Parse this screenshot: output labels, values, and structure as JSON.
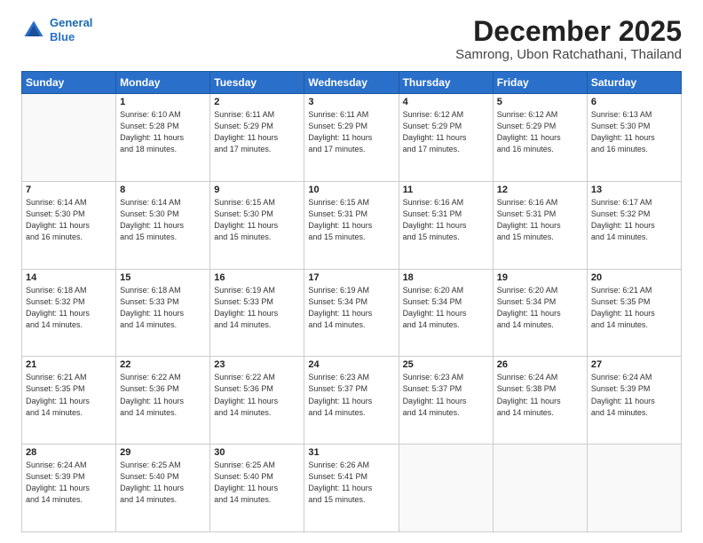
{
  "header": {
    "logo_line1": "General",
    "logo_line2": "Blue",
    "main_title": "December 2025",
    "subtitle": "Samrong, Ubon Ratchathani, Thailand"
  },
  "days_of_week": [
    "Sunday",
    "Monday",
    "Tuesday",
    "Wednesday",
    "Thursday",
    "Friday",
    "Saturday"
  ],
  "weeks": [
    [
      {
        "day": "",
        "info": ""
      },
      {
        "day": "1",
        "info": "Sunrise: 6:10 AM\nSunset: 5:28 PM\nDaylight: 11 hours\nand 18 minutes."
      },
      {
        "day": "2",
        "info": "Sunrise: 6:11 AM\nSunset: 5:29 PM\nDaylight: 11 hours\nand 17 minutes."
      },
      {
        "day": "3",
        "info": "Sunrise: 6:11 AM\nSunset: 5:29 PM\nDaylight: 11 hours\nand 17 minutes."
      },
      {
        "day": "4",
        "info": "Sunrise: 6:12 AM\nSunset: 5:29 PM\nDaylight: 11 hours\nand 17 minutes."
      },
      {
        "day": "5",
        "info": "Sunrise: 6:12 AM\nSunset: 5:29 PM\nDaylight: 11 hours\nand 16 minutes."
      },
      {
        "day": "6",
        "info": "Sunrise: 6:13 AM\nSunset: 5:30 PM\nDaylight: 11 hours\nand 16 minutes."
      }
    ],
    [
      {
        "day": "7",
        "info": "Sunrise: 6:14 AM\nSunset: 5:30 PM\nDaylight: 11 hours\nand 16 minutes."
      },
      {
        "day": "8",
        "info": "Sunrise: 6:14 AM\nSunset: 5:30 PM\nDaylight: 11 hours\nand 15 minutes."
      },
      {
        "day": "9",
        "info": "Sunrise: 6:15 AM\nSunset: 5:30 PM\nDaylight: 11 hours\nand 15 minutes."
      },
      {
        "day": "10",
        "info": "Sunrise: 6:15 AM\nSunset: 5:31 PM\nDaylight: 11 hours\nand 15 minutes."
      },
      {
        "day": "11",
        "info": "Sunrise: 6:16 AM\nSunset: 5:31 PM\nDaylight: 11 hours\nand 15 minutes."
      },
      {
        "day": "12",
        "info": "Sunrise: 6:16 AM\nSunset: 5:31 PM\nDaylight: 11 hours\nand 15 minutes."
      },
      {
        "day": "13",
        "info": "Sunrise: 6:17 AM\nSunset: 5:32 PM\nDaylight: 11 hours\nand 14 minutes."
      }
    ],
    [
      {
        "day": "14",
        "info": "Sunrise: 6:18 AM\nSunset: 5:32 PM\nDaylight: 11 hours\nand 14 minutes."
      },
      {
        "day": "15",
        "info": "Sunrise: 6:18 AM\nSunset: 5:33 PM\nDaylight: 11 hours\nand 14 minutes."
      },
      {
        "day": "16",
        "info": "Sunrise: 6:19 AM\nSunset: 5:33 PM\nDaylight: 11 hours\nand 14 minutes."
      },
      {
        "day": "17",
        "info": "Sunrise: 6:19 AM\nSunset: 5:34 PM\nDaylight: 11 hours\nand 14 minutes."
      },
      {
        "day": "18",
        "info": "Sunrise: 6:20 AM\nSunset: 5:34 PM\nDaylight: 11 hours\nand 14 minutes."
      },
      {
        "day": "19",
        "info": "Sunrise: 6:20 AM\nSunset: 5:34 PM\nDaylight: 11 hours\nand 14 minutes."
      },
      {
        "day": "20",
        "info": "Sunrise: 6:21 AM\nSunset: 5:35 PM\nDaylight: 11 hours\nand 14 minutes."
      }
    ],
    [
      {
        "day": "21",
        "info": "Sunrise: 6:21 AM\nSunset: 5:35 PM\nDaylight: 11 hours\nand 14 minutes."
      },
      {
        "day": "22",
        "info": "Sunrise: 6:22 AM\nSunset: 5:36 PM\nDaylight: 11 hours\nand 14 minutes."
      },
      {
        "day": "23",
        "info": "Sunrise: 6:22 AM\nSunset: 5:36 PM\nDaylight: 11 hours\nand 14 minutes."
      },
      {
        "day": "24",
        "info": "Sunrise: 6:23 AM\nSunset: 5:37 PM\nDaylight: 11 hours\nand 14 minutes."
      },
      {
        "day": "25",
        "info": "Sunrise: 6:23 AM\nSunset: 5:37 PM\nDaylight: 11 hours\nand 14 minutes."
      },
      {
        "day": "26",
        "info": "Sunrise: 6:24 AM\nSunset: 5:38 PM\nDaylight: 11 hours\nand 14 minutes."
      },
      {
        "day": "27",
        "info": "Sunrise: 6:24 AM\nSunset: 5:39 PM\nDaylight: 11 hours\nand 14 minutes."
      }
    ],
    [
      {
        "day": "28",
        "info": "Sunrise: 6:24 AM\nSunset: 5:39 PM\nDaylight: 11 hours\nand 14 minutes."
      },
      {
        "day": "29",
        "info": "Sunrise: 6:25 AM\nSunset: 5:40 PM\nDaylight: 11 hours\nand 14 minutes."
      },
      {
        "day": "30",
        "info": "Sunrise: 6:25 AM\nSunset: 5:40 PM\nDaylight: 11 hours\nand 14 minutes."
      },
      {
        "day": "31",
        "info": "Sunrise: 6:26 AM\nSunset: 5:41 PM\nDaylight: 11 hours\nand 15 minutes."
      },
      {
        "day": "",
        "info": ""
      },
      {
        "day": "",
        "info": ""
      },
      {
        "day": "",
        "info": ""
      }
    ]
  ]
}
